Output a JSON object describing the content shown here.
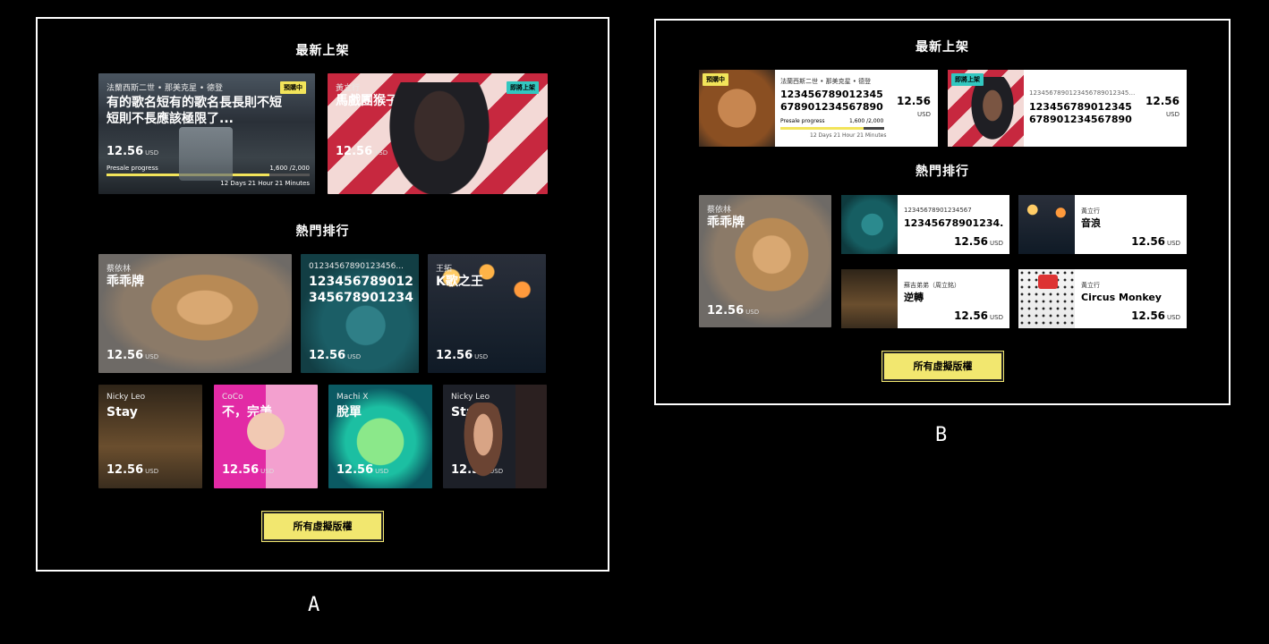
{
  "variantA": {
    "label": "A",
    "new_title": "最新上架",
    "hot_title": "熱門排行",
    "all_button": "所有虛擬版權",
    "new_cards": [
      {
        "artist": "法蘭西斯二世 • 那美克星 • 德登",
        "title": "有的歌名短有的歌名長長則不短短則不長應該極限了...",
        "price": "12.56",
        "currency": "USD",
        "badge": "預購中",
        "progress_label": "Presale progress",
        "progress_count": "1,600 /2,000",
        "progress_fraction": 0.8,
        "countdown": "12 Days  21 Hour 21 Minutes"
      },
      {
        "artist": "黃立行",
        "title": "馬戲團猴子",
        "price": "12.56",
        "currency": "USD",
        "badge": "即將上架"
      }
    ],
    "hot_row1": [
      {
        "artist": "蔡依林",
        "title": "乖乖牌",
        "price": "12.56",
        "currency": "USD"
      },
      {
        "artist": "01234567890123456...",
        "title": "12345678901234567890123456...",
        "price": "12.56",
        "currency": "USD"
      },
      {
        "artist": "王拓",
        "title": "K歌之王",
        "price": "12.56",
        "currency": "USD"
      }
    ],
    "hot_row2": [
      {
        "artist": "Nicky Leo",
        "title": "Stay",
        "price": "12.56",
        "currency": "USD"
      },
      {
        "artist": "CoCo",
        "title": "不，完美",
        "price": "12.56",
        "currency": "USD"
      },
      {
        "artist": "Machi X",
        "title": "脫單",
        "price": "12.56",
        "currency": "USD"
      },
      {
        "artist": "Nicky Leo",
        "title": "Stay",
        "price": "12.56",
        "currency": "USD"
      }
    ]
  },
  "variantB": {
    "label": "B",
    "new_title": "最新上架",
    "hot_title": "熱門排行",
    "all_button": "所有虛擬版權",
    "new_cards": [
      {
        "artist": "法蘭西斯二世 • 那美克星 • 德登",
        "title": "12345678901234567890123456789012...",
        "price": "12.56",
        "currency": "USD",
        "badge": "預購中",
        "progress_label": "Presale progress",
        "progress_count": "1,600 /2,000",
        "progress_fraction": 0.8,
        "countdown": "12 Days  21 Hour 21 Minutes"
      },
      {
        "artist": "12345678901234567890123456789012",
        "title": "12345678901234567890123456789012...",
        "price": "12.56",
        "currency": "USD",
        "badge": "即將上架"
      }
    ],
    "hot_big": {
      "artist": "蔡依林",
      "title": "乖乖牌",
      "price": "12.56",
      "currency": "USD"
    },
    "hot_small": [
      {
        "artist": "12345678901234567",
        "title": "12345678901234...",
        "price": "12.56",
        "currency": "USD"
      },
      {
        "artist": "黃立行",
        "title": "音浪",
        "price": "12.56",
        "currency": "USD"
      },
      {
        "artist": "蘇吉弟弟（周立銘）",
        "title": "逆轉",
        "price": "12.56",
        "currency": "USD"
      },
      {
        "artist": "黃立行",
        "title": "Circus Monkey",
        "price": "12.56",
        "currency": "USD"
      }
    ]
  }
}
